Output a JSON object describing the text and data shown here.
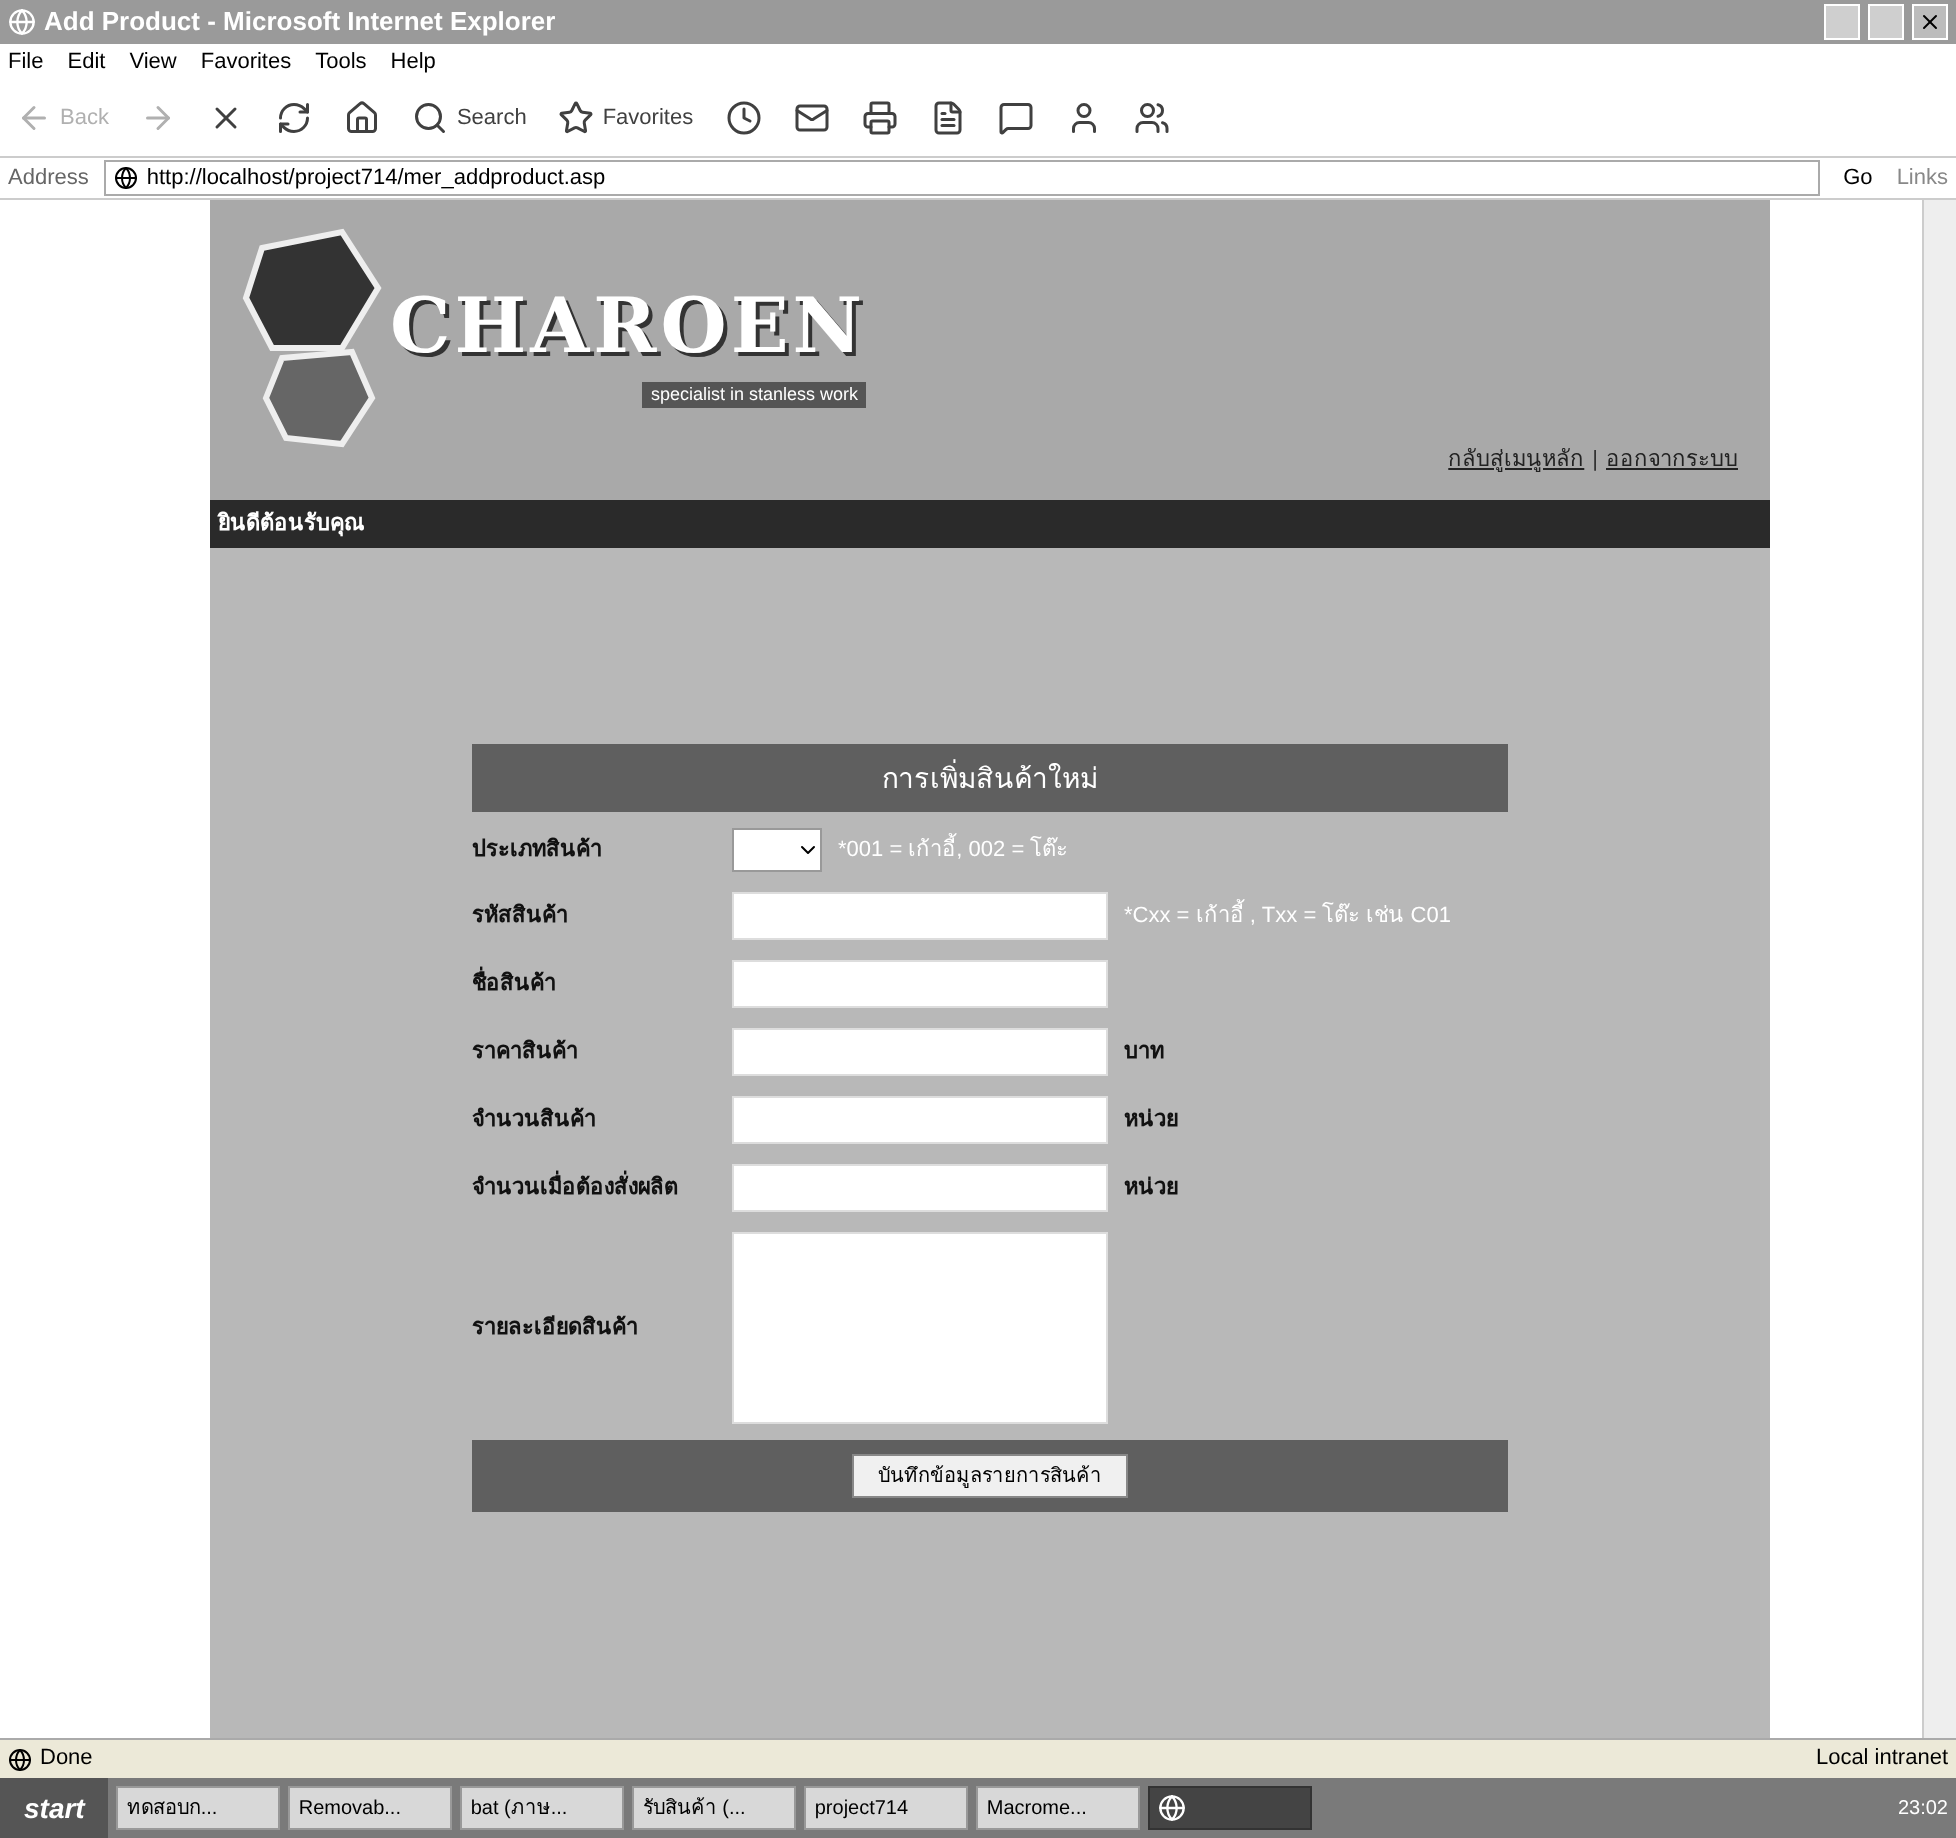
{
  "window": {
    "title": "Add Product - Microsoft Internet Explorer"
  },
  "menu": [
    "File",
    "Edit",
    "View",
    "Favorites",
    "Tools",
    "Help"
  ],
  "toolbar": [
    {
      "kind": "back",
      "label": "Back",
      "disabled": true
    },
    {
      "kind": "forward",
      "disabled": true
    },
    {
      "kind": "stop"
    },
    {
      "kind": "refresh"
    },
    {
      "kind": "home"
    },
    {
      "kind": "search",
      "label": "Search"
    },
    {
      "kind": "favorites",
      "label": "Favorites"
    },
    {
      "kind": "history"
    },
    {
      "kind": "mail"
    },
    {
      "kind": "print"
    },
    {
      "kind": "edit"
    },
    {
      "kind": "discuss"
    },
    {
      "kind": "messenger"
    },
    {
      "kind": "people"
    }
  ],
  "address": {
    "label": "Address",
    "value": "http://localhost/project714/mer_addproduct.asp",
    "go": "Go",
    "links": "Links"
  },
  "page": {
    "logo": {
      "name": "CHAROEN",
      "tagline": "specialist in stanless work"
    },
    "links": [
      "กลับสู่เมนูหลัก",
      "ออกจากระบบ"
    ],
    "link_separator": "|",
    "welcome": "ยินดีต้อนรับคุณ",
    "form": {
      "title": "การเพิ่มสินค้าใหม่",
      "fields": [
        {
          "kind": "select",
          "label": "ประเภทสินค้า",
          "note": "*001 = เก้าอี้, 002 = โต๊ะ"
        },
        {
          "kind": "text",
          "label": "รหัสสินค้า",
          "note": "*Cxx = เก้าอี้ , Txx = โต๊ะ เช่น C01"
        },
        {
          "kind": "text",
          "label": "ชื่อสินค้า"
        },
        {
          "kind": "text",
          "label": "ราคาสินค้า",
          "unit": "บาท"
        },
        {
          "kind": "text",
          "label": "จำนวนสินค้า",
          "unit": "หน่วย"
        },
        {
          "kind": "text",
          "label": "จำนวนเมื่อต้องสั่งผลิต",
          "unit": "หน่วย"
        },
        {
          "kind": "textarea",
          "label": "รายละเอียดสินค้า"
        }
      ],
      "submit": "บันทึกข้อมูลรายการสินค้า"
    }
  },
  "status_bar": {
    "text": "Done",
    "zone": "Local intranet"
  },
  "taskbar": {
    "start": "start",
    "items": [
      {
        "label": "ทดสอบก...",
        "selected": false
      },
      {
        "label": "Removab...",
        "selected": false
      },
      {
        "label": "bat (ภาษ...",
        "selected": false
      },
      {
        "label": "รับสินค้า (...",
        "selected": false
      },
      {
        "label": "project714",
        "selected": false
      },
      {
        "label": "Macrome...",
        "selected": false
      },
      {
        "selected": true
      }
    ],
    "clock": "23:02"
  }
}
